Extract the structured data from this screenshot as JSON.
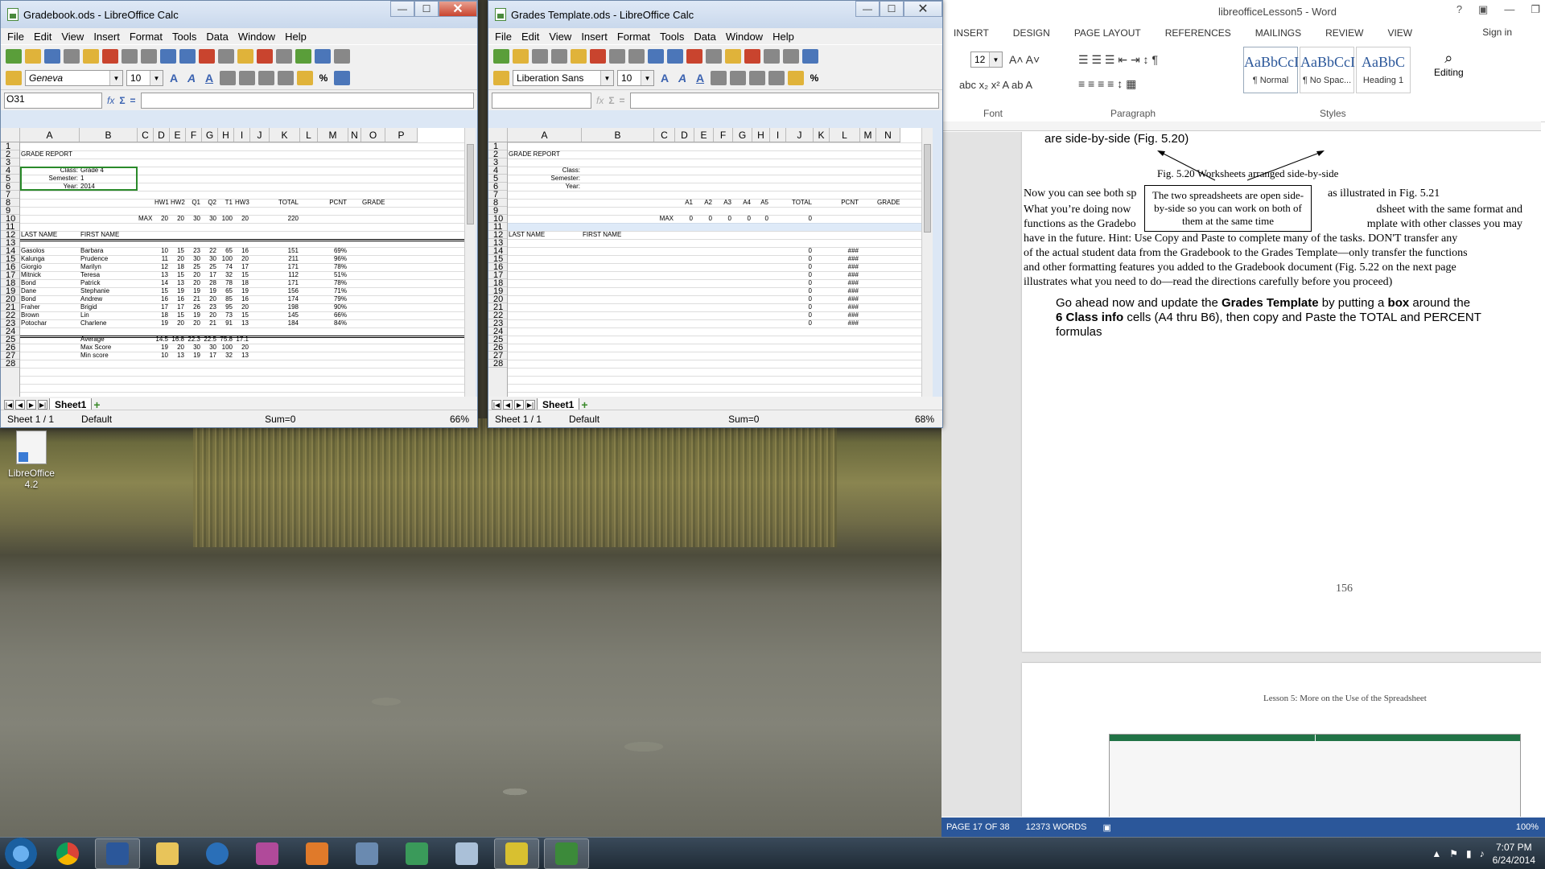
{
  "desktop": {
    "icon_label": "LibreOffice 4.2"
  },
  "calc1": {
    "title": "Gradebook.ods - LibreOffice Calc",
    "menus": [
      "File",
      "Edit",
      "View",
      "Insert",
      "Format",
      "Tools",
      "Data",
      "Window",
      "Help"
    ],
    "font": "Geneva",
    "size": "10",
    "namebox": "O31",
    "columns": [
      "A",
      "B",
      "C",
      "D",
      "E",
      "F",
      "G",
      "H",
      "I",
      "J",
      "K",
      "L",
      "M",
      "N",
      "O",
      "P"
    ],
    "rows": [
      "1",
      "2",
      "3",
      "4",
      "5",
      "6",
      "7",
      "8",
      "9",
      "10",
      "11",
      "12",
      "13",
      "14",
      "15",
      "16",
      "17",
      "18",
      "19",
      "20",
      "21",
      "22",
      "23",
      "24",
      "25",
      "26",
      "27",
      "28"
    ],
    "heading": "GRADE REPORT",
    "class_labels": [
      "Class:",
      "Semester:",
      "Year:"
    ],
    "class_values": [
      "Grade 4",
      "1",
      "2014"
    ],
    "col_heads": [
      "HW1",
      "HW2",
      "Q1",
      "Q2",
      "T1",
      "HW3",
      "TOTAL",
      "PCNT",
      "GRADE"
    ],
    "max_label": "MAX",
    "max_values": [
      "20",
      "20",
      "30",
      "30",
      "100",
      "20",
      "220"
    ],
    "last_name": "LAST NAME",
    "first_name": "FIRST NAME",
    "students": [
      {
        "last": "Gasolos",
        "first": "Barbara",
        "s": [
          "10",
          "15",
          "23",
          "22",
          "65",
          "16"
        ],
        "total": "151",
        "pcnt": "69%"
      },
      {
        "last": "Kalunga",
        "first": "Prudence",
        "s": [
          "11",
          "20",
          "30",
          "30",
          "100",
          "20"
        ],
        "total": "211",
        "pcnt": "96%"
      },
      {
        "last": "Giorgio",
        "first": "Marilyn",
        "s": [
          "12",
          "18",
          "25",
          "25",
          "74",
          "17"
        ],
        "total": "171",
        "pcnt": "78%"
      },
      {
        "last": "Mitnick",
        "first": "Teresa",
        "s": [
          "13",
          "15",
          "20",
          "17",
          "32",
          "15"
        ],
        "total": "112",
        "pcnt": "51%"
      },
      {
        "last": "Bond",
        "first": "Patrick",
        "s": [
          "14",
          "13",
          "20",
          "28",
          "78",
          "18"
        ],
        "total": "171",
        "pcnt": "78%"
      },
      {
        "last": "Dane",
        "first": "Stephanie",
        "s": [
          "15",
          "19",
          "19",
          "19",
          "65",
          "19"
        ],
        "total": "156",
        "pcnt": "71%"
      },
      {
        "last": "Bond",
        "first": "Andrew",
        "s": [
          "16",
          "16",
          "21",
          "20",
          "85",
          "16"
        ],
        "total": "174",
        "pcnt": "79%"
      },
      {
        "last": "Fraher",
        "first": "Brigid",
        "s": [
          "17",
          "17",
          "26",
          "23",
          "95",
          "20"
        ],
        "total": "198",
        "pcnt": "90%"
      },
      {
        "last": "Brown",
        "first": "Lin",
        "s": [
          "18",
          "15",
          "19",
          "20",
          "73",
          "15"
        ],
        "total": "145",
        "pcnt": "66%"
      },
      {
        "last": "Potochar",
        "first": "Charlene",
        "s": [
          "19",
          "20",
          "20",
          "21",
          "91",
          "13"
        ],
        "total": "184",
        "pcnt": "84%"
      }
    ],
    "stats": [
      {
        "label": "Average",
        "v": [
          "14.5",
          "16.8",
          "22.3",
          "22.5",
          "75.8",
          "17.1"
        ]
      },
      {
        "label": "Max Score",
        "v": [
          "19",
          "20",
          "30",
          "30",
          "100",
          "20"
        ]
      },
      {
        "label": "Min score",
        "v": [
          "10",
          "13",
          "19",
          "17",
          "32",
          "13"
        ]
      }
    ],
    "sheet_tab": "Sheet1",
    "status_sheet": "Sheet 1 / 1",
    "status_style": "Default",
    "status_sum": "Sum=0",
    "zoom": "66%"
  },
  "calc2": {
    "title": "Grades Template.ods - LibreOffice Calc",
    "menus": [
      "File",
      "Edit",
      "View",
      "Insert",
      "Format",
      "Tools",
      "Data",
      "Window",
      "Help"
    ],
    "font": "Liberation Sans",
    "size": "10",
    "columns": [
      "A",
      "B",
      "C",
      "D",
      "E",
      "F",
      "G",
      "H",
      "I",
      "J",
      "K",
      "L",
      "M",
      "N"
    ],
    "rows": [
      "1",
      "2",
      "3",
      "4",
      "5",
      "6",
      "7",
      "8",
      "9",
      "10",
      "11",
      "12",
      "13",
      "14",
      "15",
      "16",
      "17",
      "18",
      "19",
      "20",
      "21",
      "22",
      "23",
      "24",
      "25",
      "26",
      "27",
      "28"
    ],
    "heading": "GRADE REPORT",
    "class_labels": [
      "Class:",
      "Semester:",
      "Year:"
    ],
    "col_heads": [
      "A1",
      "A2",
      "A3",
      "A4",
      "A5",
      "TOTAL",
      "PCNT",
      "GRADE"
    ],
    "max_label": "MAX",
    "max_values": [
      "0",
      "0",
      "0",
      "0",
      "0",
      "0"
    ],
    "last_name": "LAST NAME",
    "first_name": "FIRST NAME",
    "zero": "0",
    "hash": "###",
    "sheet_tab": "Sheet1",
    "status_sheet": "Sheet 1 / 1",
    "status_style": "Default",
    "status_sum": "Sum=0",
    "zoom": "68%"
  },
  "word": {
    "title": "libreofficeLesson5 - Word",
    "tabs": [
      "INSERT",
      "DESIGN",
      "PAGE LAYOUT",
      "REFERENCES",
      "MAILINGS",
      "REVIEW",
      "VIEW"
    ],
    "signin": "Sign in",
    "font_size": "12",
    "styles": [
      {
        "preview": "AaBbCcI",
        "name": "¶ Normal"
      },
      {
        "preview": "AaBbCcI",
        "name": "¶ No Spac..."
      },
      {
        "preview": "AaBbC",
        "name": "Heading 1"
      }
    ],
    "editing": "Editing",
    "groups": [
      "Font",
      "Paragraph",
      "Styles"
    ],
    "text_top": "are side-by-side (Fig. 5.20)",
    "fig_caption": "Fig. 5.20 Worksheets arranged side-by-side",
    "callout": "The two spreadsheets are open side-by-side so you can work on both of them at the same time",
    "p1_start": "Now you can see both sp",
    "p1_end": "as illustrated in Fig. 5.21",
    "p2_l1a": "What you’re doing now",
    "p2_l1b": "dsheet with the same format and",
    "p2_l2a": "functions as the Gradebo",
    "p2_l2b": "mplate with other classes you may",
    "p2_l3": "have in the future. Hint: Use Copy and Paste to complete many of the tasks. DON'T transfer any",
    "p2_l4": "of the actual student data from the Gradebook to the Grades Template—only transfer the functions",
    "p2_l5": "and other formatting features you added to the Gradebook document (Fig. 5.22 on the next page",
    "p2_l6": "illustrates what you need to do—read the directions carefully before you proceed)",
    "instr_1a": "Go ahead now and update the ",
    "instr_1b": "Grades Template",
    "instr_1c": " by putting a ",
    "instr_1d": "box",
    "instr_1e": " around the",
    "instr_2a": "6 Class info",
    "instr_2b": " cells (A4 thru B6), then copy and Paste the TOTAL and PERCENT",
    "instr_3": "formulas",
    "page_number": "156",
    "next_header": "Lesson 5: More on the Use of the Spreadsheet",
    "status_page": "PAGE 17 OF 38",
    "status_words": "12373 WORDS",
    "status_zoom": "100%"
  },
  "taskbar": {
    "time": "7:07 PM",
    "date": "6/24/2014"
  }
}
